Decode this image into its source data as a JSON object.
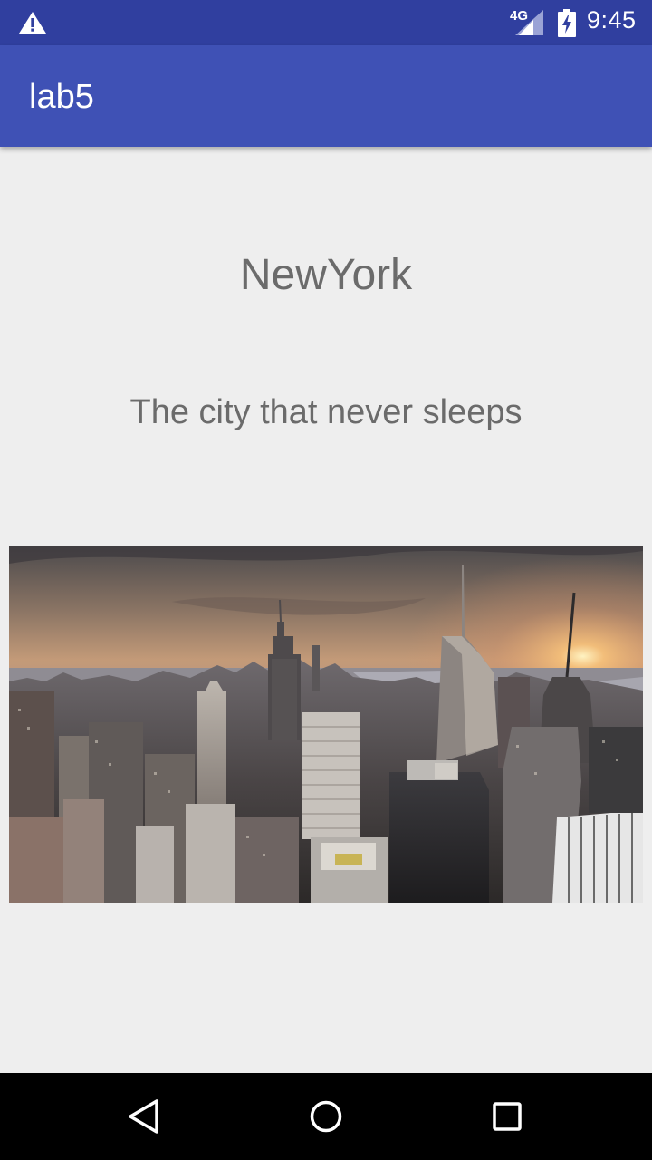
{
  "status_bar": {
    "network": "4G",
    "time": "9:45",
    "icons": [
      "warning-icon",
      "signal-icon",
      "battery-charging-icon"
    ]
  },
  "app_bar": {
    "title": "lab5",
    "background": "#3f51b5"
  },
  "content": {
    "city_name": "NewYork",
    "tagline": "The city that never sleeps",
    "image_icon": "new-york-skyline-photo"
  },
  "nav_bar": {
    "icons": [
      "back-icon",
      "home-icon",
      "recents-icon"
    ]
  },
  "colors": {
    "status_bar": "#303f9f",
    "app_bar": "#3f51b5",
    "background": "#eeeeee",
    "text": "#6b6b6b"
  }
}
